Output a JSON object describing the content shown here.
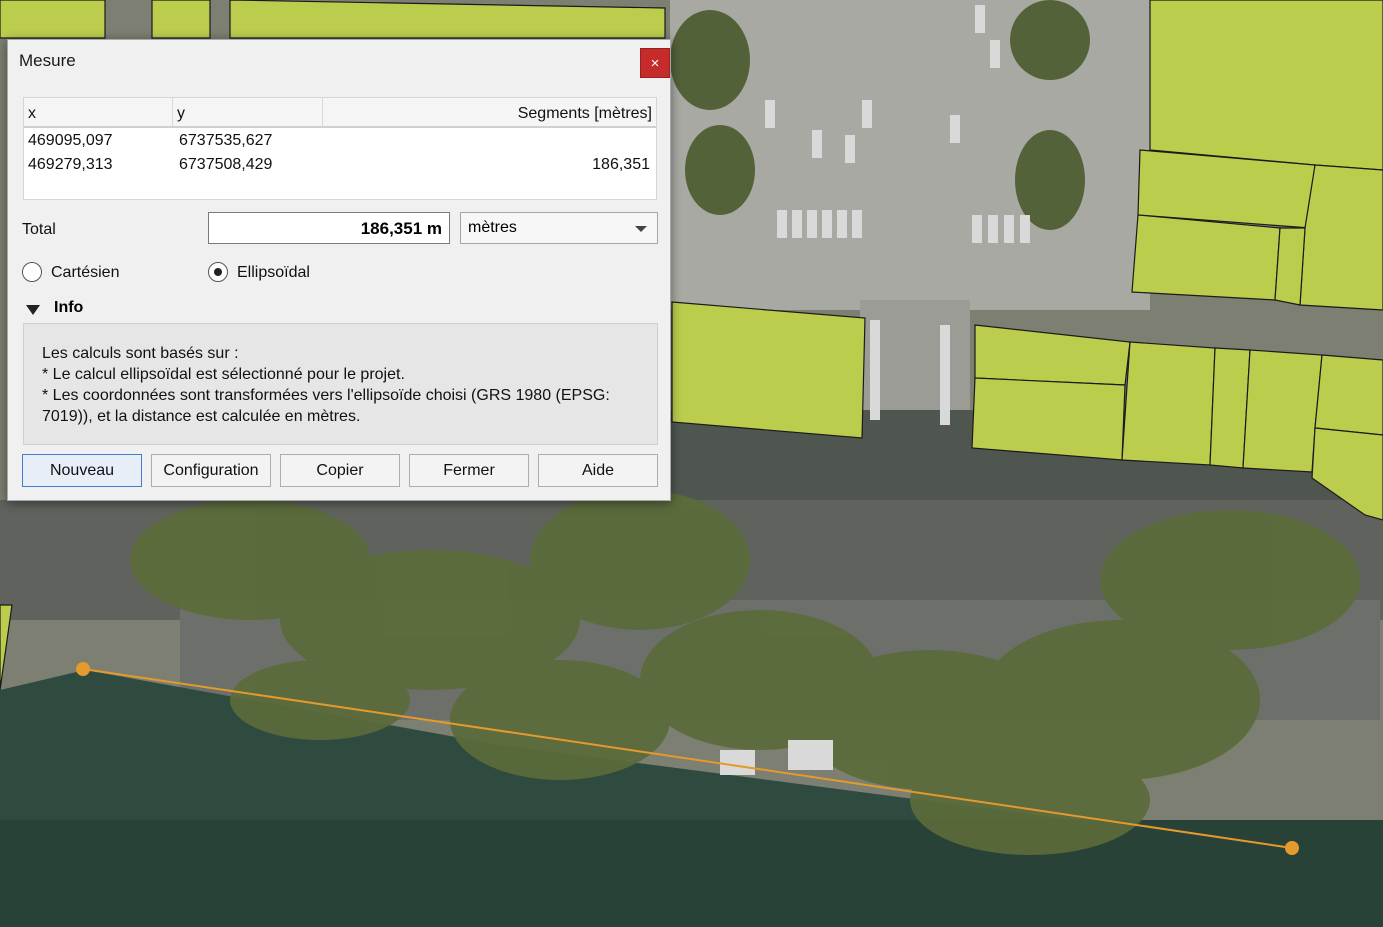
{
  "dialog": {
    "title": "Mesure",
    "close_glyph": "×",
    "table": {
      "headers": [
        "x",
        "y",
        "Segments [mètres]"
      ],
      "rows": [
        {
          "x": "469095,097",
          "y": "6737535,627",
          "segment": ""
        },
        {
          "x": "469279,313",
          "y": "6737508,429",
          "segment": "186,351"
        }
      ]
    },
    "total_label": "Total",
    "total_value": "186,351 m",
    "unit_selected": "mètres",
    "radio_cartesian": "Cartésien",
    "radio_ellipsoidal": "Ellipsoïdal",
    "selected_mode": "Ellipsoïdal",
    "info_title": "Info",
    "info_lines": [
      "Les calculs sont basés sur :",
      "* Le calcul ellipsoïdal est sélectionné pour le projet.",
      "* Les coordonnées sont transformées vers l'ellipsoïde choisi (GRS 1980 (EPSG:",
      "7019)), et la distance est calculée en mètres."
    ],
    "buttons": {
      "new": "Nouveau",
      "config": "Configuration",
      "copy": "Copier",
      "close": "Fermer",
      "help": "Aide"
    }
  },
  "colors": {
    "parcel_fill": "#bccc4d",
    "measure_line": "#e49a2c",
    "close_button": "#c42b2b"
  }
}
